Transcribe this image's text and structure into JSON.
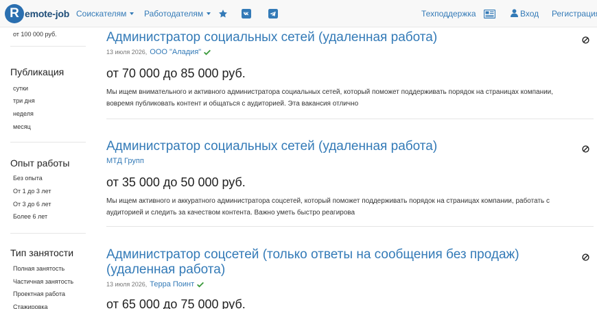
{
  "navbar": {
    "brand_letter": "R",
    "brand_text": "emote-job",
    "seekers_label": "Соискателям",
    "employers_label": "Работодателям",
    "support_label": "Техподдержка",
    "login_label": "Вход",
    "register_label": "Регистрация",
    "colors": {
      "link": "#337ab7",
      "brand": "#2a6fb0"
    },
    "icons": [
      "star-icon",
      "vk-icon",
      "telegram-icon",
      "newspaper-icon",
      "user-icon"
    ]
  },
  "sidebar": {
    "salary_tail": "от 100 000 руб.",
    "publication": {
      "heading": "Публикация",
      "items": [
        "сутки",
        "три дня",
        "неделя",
        "месяц"
      ]
    },
    "experience": {
      "heading": "Опыт работы",
      "items": [
        "Без опыта",
        "От 1 до 3 лет",
        "От 3 до 6 лет",
        "Более 6 лет"
      ]
    },
    "employment": {
      "heading": "Тип занятости",
      "items": [
        "Полная занятость",
        "Частичная занятость",
        "Проектная работа",
        "Стажировка"
      ]
    }
  },
  "jobs": [
    {
      "title": "Администратор социальных сетей (удаленная работа)",
      "date": "13 июля 2026,",
      "company": "ООО \"Аладия\"",
      "verified": true,
      "salary": "от 70 000 до 85 000 руб.",
      "description": "Мы ищем внимательного и активного администратора социальных сетей, который поможет поддерживать порядок на страницах компании, вовремя публиковать контент и общаться с аудиторией. Эта вакансия отлично"
    },
    {
      "title": "Администратор социальных сетей (удаленная работа)",
      "date": "",
      "company": "МТД Групп",
      "verified": false,
      "salary": "от 35 000 до 50 000 руб.",
      "description": "Мы ищем активного и аккуратного администратора соцсетей, который поможет поддерживать порядок на страницах компании, работать с аудиторией и следить за качеством контента. Важно уметь быстро реагирова"
    },
    {
      "title": "Администратор соцсетей (только ответы на сообщения без продаж) (удаленная работа)",
      "date": "13 июля 2026,",
      "company": "Терра Поинт",
      "verified": true,
      "salary": "от 65 000 до 75 000 руб."
    }
  ]
}
